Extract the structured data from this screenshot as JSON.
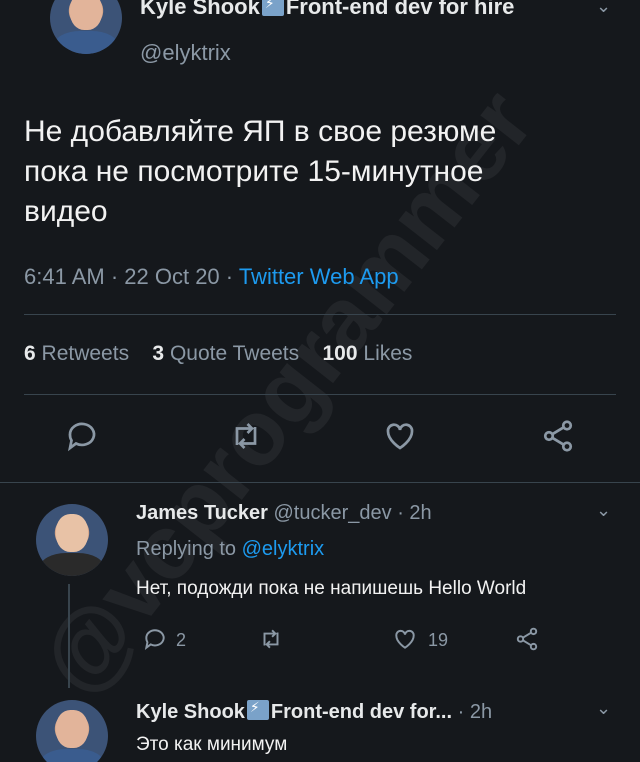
{
  "tweet": {
    "author_name": "Kyle Shook",
    "author_title": "Front-end dev for hire",
    "handle": "@elyktrix",
    "text_line1": "Не добавляйте ЯП в свое резюме",
    "text_line2": "пока не посмотрите 15-минутное",
    "text_line3": "видео",
    "time": "6:41 AM",
    "date": "22 Oct 20",
    "source": "Twitter Web App",
    "retweets_count": "6",
    "retweets_label": "Retweets",
    "quotes_count": "3",
    "quotes_label": "Quote Tweets",
    "likes_count": "100",
    "likes_label": "Likes"
  },
  "replies": [
    {
      "name": "James Tucker",
      "handle": "@tucker_dev",
      "age": "2h",
      "replying_to_prefix": "Replying to",
      "replying_to_handle": "@elyktrix",
      "text": "Нет, подожди пока не напишешь Hello World",
      "reply_count": "2",
      "like_count": "19"
    },
    {
      "name": "Kyle Shook",
      "title_truncated": "Front-end dev for...",
      "age": "2h",
      "text": "Это как минимум"
    }
  ],
  "watermark": "@vcprogrammer",
  "colors": {
    "background": "#15181c",
    "accent": "#1d9bf0",
    "muted": "#8b98a5"
  },
  "icons": [
    "chevron-down-icon",
    "reply-icon",
    "retweet-icon",
    "like-icon",
    "share-icon",
    "lightning-badge-icon"
  ]
}
